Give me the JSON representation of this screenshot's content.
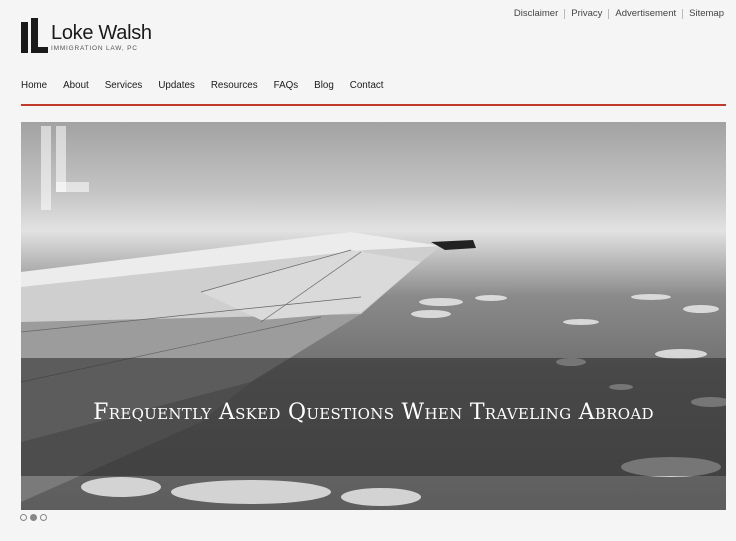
{
  "utility_links": [
    "Disclaimer",
    "Privacy",
    "Advertisement",
    "Sitemap"
  ],
  "logo": {
    "name": "Loke Walsh",
    "subtitle": "IMMIGRATION LAW, PC"
  },
  "nav": [
    "Home",
    "About",
    "Services",
    "Updates",
    "Resources",
    "FAQs",
    "Blog",
    "Contact"
  ],
  "hero": {
    "caption": "Frequently Asked Questions When Traveling Abroad"
  },
  "slider": {
    "count": 3,
    "active_index": 1
  },
  "colors": {
    "accent_rule": "#c0392b",
    "text": "#1a1a1a",
    "background": "#f5f5f5"
  }
}
